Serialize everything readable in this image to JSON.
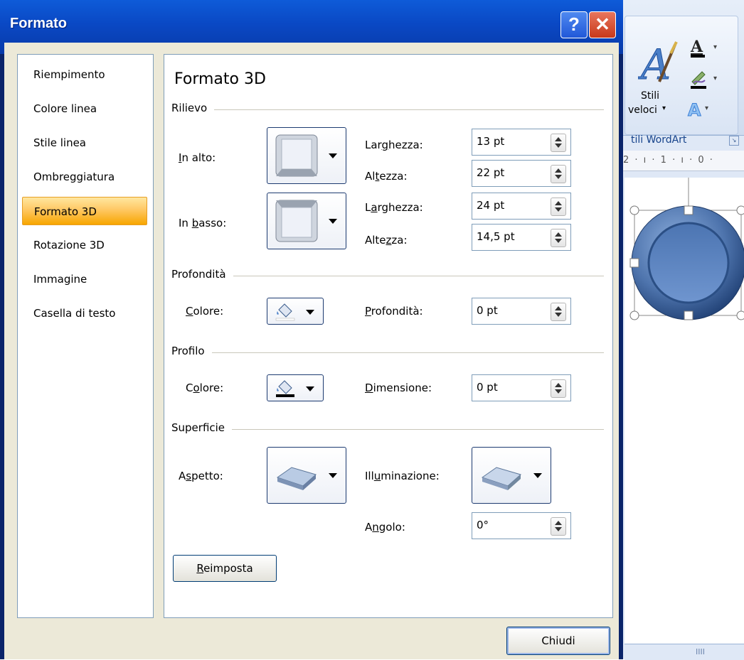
{
  "dialog": {
    "title": "Formato",
    "help_glyph": "?",
    "close_glyph": "✕",
    "close_button": "Chiudi"
  },
  "nav": {
    "items": [
      {
        "label": "Riempimento"
      },
      {
        "label": "Colore linea"
      },
      {
        "label": "Stile linea"
      },
      {
        "label": "Ombreggiatura"
      },
      {
        "label": "Formato 3D",
        "active": true
      },
      {
        "label": "Rotazione 3D"
      },
      {
        "label": "Immagine"
      },
      {
        "label": "Casella di testo"
      }
    ]
  },
  "panel": {
    "title": "Formato 3D",
    "rilievo": {
      "section": "Rilievo",
      "top_label_u": "I",
      "top_label_rest": "n alto:",
      "bottom_label_pre": "In ",
      "bottom_label_u": "b",
      "bottom_label_rest": "asso:",
      "width_label_pre": "Lar",
      "width_label_u": "g",
      "width_label_rest": "hezza:",
      "height_label_pre": "Al",
      "height_label_u": "t",
      "height_label_rest": "ezza:",
      "width2_label_pre": "L",
      "width2_label_u": "a",
      "width2_label_rest": "rghezza:",
      "height2_label_pre": "Alte",
      "height2_label_u": "z",
      "height2_label_rest": "za:",
      "top_width": "13 pt",
      "top_height": "22 pt",
      "bottom_width": "24 pt",
      "bottom_height": "14,5 pt"
    },
    "profondita": {
      "section": "Profondità",
      "color_label_u": "C",
      "color_label_rest": "olore:",
      "depth_label_u": "P",
      "depth_label_rest": "rofondità:",
      "depth_value": "0 pt"
    },
    "profilo": {
      "section": "Profilo",
      "color_label_pre": "C",
      "color_label_u": "o",
      "color_label_rest": "lore:",
      "size_label_u": "D",
      "size_label_rest": "imensione:",
      "size_value": "0 pt"
    },
    "superficie": {
      "section": "Superficie",
      "material_label_pre": "A",
      "material_label_u": "s",
      "material_label_rest": "petto:",
      "lighting_label_pre": "Ill",
      "lighting_label_u": "u",
      "lighting_label_rest": "minazione:",
      "angle_label_pre": "A",
      "angle_label_u": "n",
      "angle_label_rest": "golo:",
      "angle_value": "0°"
    },
    "reset_u": "R",
    "reset_rest": "eimposta"
  },
  "ribbon": {
    "stili": "Stili",
    "veloci": "veloci",
    "group_caption": "tili WordArt",
    "ruler_text": "2 · ı · 1 · ı · 0 ·",
    "scroll_grip": "IIII"
  },
  "colors": {
    "titlebar": "#0a48c4",
    "dialog_bg": "#ece9d8",
    "active_item": "#ffc864",
    "shape_fill": "#4f78b0"
  },
  "icons": [
    "help-icon",
    "close-icon",
    "wordart-icon",
    "font-color-icon",
    "pen-icon",
    "text-effects-icon",
    "paint-bucket-icon",
    "bevel-icon",
    "material-icon",
    "lighting-icon"
  ]
}
